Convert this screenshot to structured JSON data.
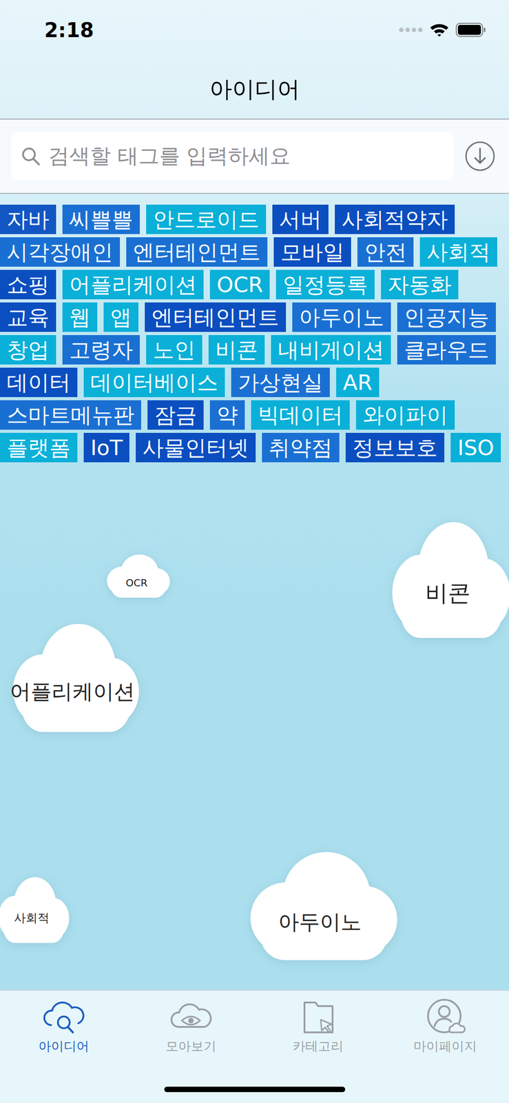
{
  "status_bar": {
    "time": "2:18"
  },
  "nav": {
    "title": "아이디어"
  },
  "search": {
    "placeholder": "검색할 태그를 입력하세요"
  },
  "tags": [
    {
      "label": "자바",
      "color": "#1256c4"
    },
    {
      "label": "씨쁠쁠",
      "color": "#1a70d2"
    },
    {
      "label": "안드로이드",
      "color": "#0ab0d8"
    },
    {
      "label": "서버",
      "color": "#0b4ec0"
    },
    {
      "label": "사회적약자",
      "color": "#0b4ec0"
    },
    {
      "label": "시각장애인",
      "color": "#1a70d2"
    },
    {
      "label": "엔터테인먼트",
      "color": "#1a70d2"
    },
    {
      "label": "모바일",
      "color": "#0b4ec0"
    },
    {
      "label": "안전",
      "color": "#1a70d2"
    },
    {
      "label": "사회적",
      "color": "#0ab0d8"
    },
    {
      "label": "쇼핑",
      "color": "#0b4ec0"
    },
    {
      "label": "어플리케이션",
      "color": "#0ab0d8"
    },
    {
      "label": "OCR",
      "color": "#0ab0d8"
    },
    {
      "label": "일정등록",
      "color": "#0ab0d8"
    },
    {
      "label": "자동화",
      "color": "#0ab0d8"
    },
    {
      "label": "교육",
      "color": "#0b4ec0"
    },
    {
      "label": "웹",
      "color": "#0ab0d8"
    },
    {
      "label": "앱",
      "color": "#0ab0d8"
    },
    {
      "label": "엔터테인먼트",
      "color": "#0b4ec0"
    },
    {
      "label": "아두이노",
      "color": "#1a70d2"
    },
    {
      "label": "인공지능",
      "color": "#1a70d2"
    },
    {
      "label": "창업",
      "color": "#0ab0d8"
    },
    {
      "label": "고령자",
      "color": "#1a70d2"
    },
    {
      "label": "노인",
      "color": "#0ab0d8"
    },
    {
      "label": "비콘",
      "color": "#0ab0d8"
    },
    {
      "label": "내비게이션",
      "color": "#0ab0d8"
    },
    {
      "label": "클라우드",
      "color": "#1a70d2"
    },
    {
      "label": "데이터",
      "color": "#0b4ec0"
    },
    {
      "label": "데이터베이스",
      "color": "#0ab0d8"
    },
    {
      "label": "가상현실",
      "color": "#1a70d2"
    },
    {
      "label": "AR",
      "color": "#0ab0d8"
    },
    {
      "label": "스마트메뉴판",
      "color": "#1a70d2"
    },
    {
      "label": "잠금",
      "color": "#0b4ec0"
    },
    {
      "label": "약",
      "color": "#1a70d2"
    },
    {
      "label": "빅데이터",
      "color": "#0ab0d8"
    },
    {
      "label": "와이파이",
      "color": "#0ab0d8"
    },
    {
      "label": "플랫폼",
      "color": "#0ab0d8"
    },
    {
      "label": "IoT",
      "color": "#0b4ec0"
    },
    {
      "label": "사물인터넷",
      "color": "#0b4ec0"
    },
    {
      "label": "취약점",
      "color": "#1a70d2"
    },
    {
      "label": "정보보호",
      "color": "#0b4ec0"
    },
    {
      "label": "ISO",
      "color": "#0ab0d8"
    }
  ],
  "clouds": [
    {
      "label": "OCR"
    },
    {
      "label": "비콘"
    },
    {
      "label": "어플리케이션"
    },
    {
      "label": "사회적"
    },
    {
      "label": "아두이노"
    }
  ],
  "tabs": [
    {
      "label": "아이디어",
      "selected": true
    },
    {
      "label": "모아보기",
      "selected": false
    },
    {
      "label": "카테고리",
      "selected": false
    },
    {
      "label": "마이페이지",
      "selected": false
    }
  ]
}
